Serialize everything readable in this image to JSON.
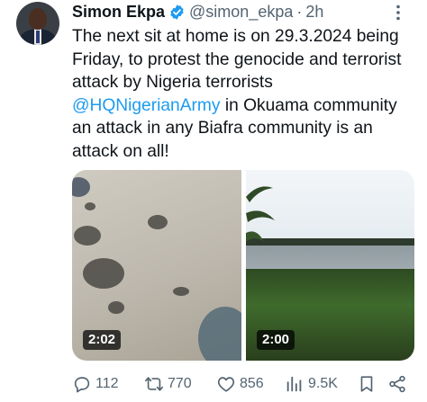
{
  "tweet": {
    "author_name": "Simon Ekpa",
    "handle": "@simon_ekpa",
    "separator": "·",
    "time": "2h",
    "text_before_mention": "The next sit at home is on 29.3.2024 being Friday, to protest the genocide and terrorist attack by Nigeria terrorists ",
    "mention": "@HQNigerianArmy",
    "text_after_mention": " in Okuama community an attack in any Biafra community is an attack on all!"
  },
  "media": [
    {
      "kind": "video",
      "duration": "2:02"
    },
    {
      "kind": "video",
      "duration": "2:00"
    }
  ],
  "actions": {
    "replies": "112",
    "reposts": "770",
    "likes": "856",
    "views": "9.5K"
  },
  "icons": {
    "verified": "verified-badge-icon",
    "more": "more-icon",
    "reply": "reply-icon",
    "repost": "repost-icon",
    "like": "heart-icon",
    "views": "views-icon",
    "bookmark": "bookmark-icon",
    "share": "share-icon"
  },
  "colors": {
    "accent": "#1d9bf0",
    "text": "#0f1419",
    "secondary": "#536471"
  }
}
